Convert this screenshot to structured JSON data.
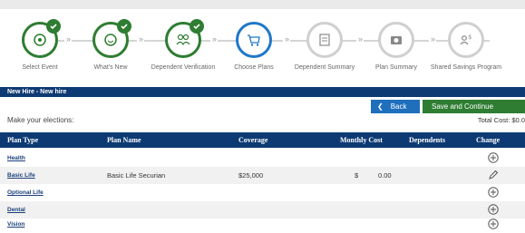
{
  "stepper": {
    "steps": [
      {
        "label": "Select Event",
        "state": "done",
        "icon": "gear-icon"
      },
      {
        "label": "What's New",
        "state": "done",
        "icon": "smile-icon"
      },
      {
        "label": "Dependent Verification",
        "state": "done",
        "icon": "people-icon"
      },
      {
        "label": "Choose Plans",
        "state": "current",
        "icon": "cart-icon"
      },
      {
        "label": "Dependent Summary",
        "state": "todo",
        "icon": "document-icon"
      },
      {
        "label": "Plan Summary",
        "state": "todo",
        "icon": "camera-icon"
      },
      {
        "label": "Shared Savings Program",
        "state": "todo",
        "icon": "money-people-icon"
      }
    ]
  },
  "band": {
    "title": "New Hire - New hire"
  },
  "actions": {
    "back_label": "Back",
    "save_label": "Save and Continue"
  },
  "elections": {
    "prompt": "Make your elections:",
    "total_cost": "Total Cost: $0.0"
  },
  "table": {
    "headers": {
      "plan_type": "Plan Type",
      "plan_name": "Plan Name",
      "coverage": "Coverage",
      "monthly_cost": "Monthly Cost",
      "dependents": "Dependents",
      "change": "Change"
    },
    "rows": [
      {
        "plan_type": "Health",
        "plan_name": "",
        "coverage": "",
        "currency": "",
        "cost": "",
        "action": "add-circle-icon"
      },
      {
        "plan_type": "Basic Life",
        "plan_name": "Basic Life Securian",
        "coverage": "$25,000",
        "currency": "$",
        "cost": "0.00",
        "action": "pencil-edit-icon"
      },
      {
        "plan_type": "Optional Life",
        "plan_name": "",
        "coverage": "",
        "currency": "",
        "cost": "",
        "action": "add-circle-icon"
      },
      {
        "plan_type": "Dental",
        "plan_name": "",
        "coverage": "",
        "currency": "",
        "cost": "",
        "action": "add-circle-icon"
      },
      {
        "plan_type": "Vision",
        "plan_name": "",
        "coverage": "",
        "currency": "",
        "cost": "",
        "action": "add-circle-icon"
      }
    ]
  },
  "colors": {
    "done": "#2e7d32",
    "current": "#1f78c8",
    "header_navy": "#0d3a73",
    "back_blue": "#1f6fbd",
    "save_green": "#2e7d32"
  }
}
